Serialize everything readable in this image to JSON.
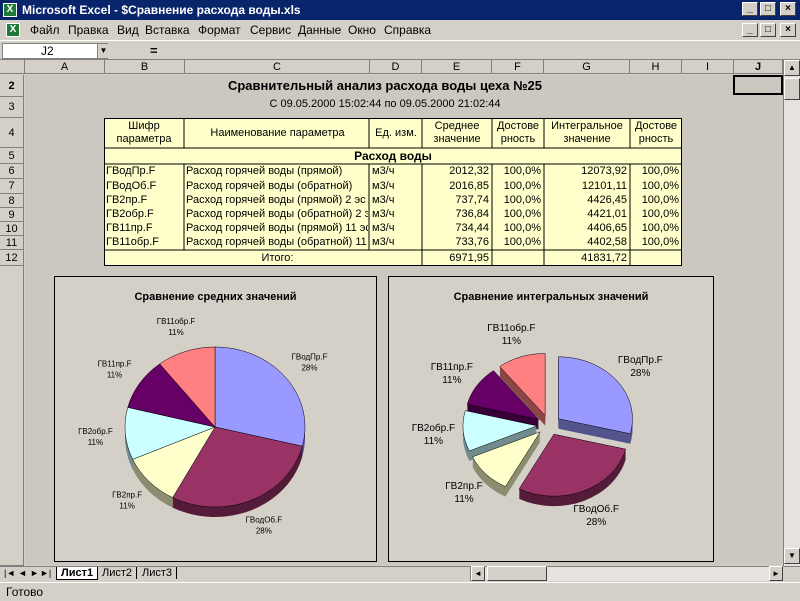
{
  "app": {
    "title": "Microsoft Excel - $Сравнение расхода воды.xls",
    "icon": "excel-icon"
  },
  "menu": [
    "Файл",
    "Правка",
    "Вид",
    "Вставка",
    "Формат",
    "Сервис",
    "Данные",
    "Окно",
    "Справка"
  ],
  "namebox": "J2",
  "formula_sign": "=",
  "columns": [
    "A",
    "B",
    "C",
    "D",
    "E",
    "F",
    "G",
    "H",
    "I",
    "J"
  ],
  "rows": [
    "2",
    "3",
    "4",
    "5",
    "6",
    "7",
    "8",
    "9",
    "10",
    "11",
    "12"
  ],
  "sheet": {
    "title": "Сравнительный анализ расхода воды цеха №25",
    "period": "С 09.05.2000 15:02:44 по 09.05.2000 21:02:44",
    "headers": [
      "Шифр параметра",
      "Наименование параметра",
      "Ед. изм.",
      "Среднее значение",
      "Достове рность",
      "Интегральное значение",
      "Достове рность"
    ],
    "section": "Расход воды",
    "table_rows": [
      [
        "ГВодПр.F",
        "Расход горячей воды (прямой)",
        "м3/ч",
        "2012,32",
        "100,0%",
        "12073,92",
        "100,0%"
      ],
      [
        "ГВодОб.F",
        "Расход горячей воды (обратной)",
        "м3/ч",
        "2016,85",
        "100,0%",
        "12101,11",
        "100,0%"
      ],
      [
        "ГВ2пр.F",
        "Расход горячей воды (прямой) 2 эс",
        "м3/ч",
        "737,74",
        "100,0%",
        "4426,45",
        "100,0%"
      ],
      [
        "ГВ2обр.F",
        "Расход горячей воды (обратной) 2 э",
        "м3/ч",
        "736,84",
        "100,0%",
        "4421,01",
        "100,0%"
      ],
      [
        "ГВ11пр.F",
        "Расход горячей воды (прямой) 11 эс",
        "м3/ч",
        "734,44",
        "100,0%",
        "4406,65",
        "100,0%"
      ],
      [
        "ГВ11обр.F",
        "Расход горячей воды (обратной) 11",
        "м3/ч",
        "733,76",
        "100,0%",
        "4402,58",
        "100,0%"
      ]
    ],
    "total_label": "Итого:",
    "total_avg": "6971,95",
    "total_int": "41831,72"
  },
  "chart_data": [
    {
      "type": "pie",
      "title": "Сравнение средних значений",
      "categories": [
        "ГВодПр.F",
        "ГВодОб.F",
        "ГВ2пр.F",
        "ГВ2обр.F",
        "ГВ11пр.F",
        "ГВ11обр.F"
      ],
      "values": [
        2012.32,
        2016.85,
        737.74,
        736.84,
        734.44,
        733.76
      ],
      "labels": [
        "28%",
        "28%",
        "11%",
        "11%",
        "11%",
        "11%"
      ],
      "colors": [
        "#9999ff",
        "#993366",
        "#ffffcc",
        "#ccffff",
        "#660066",
        "#ff8080"
      ]
    },
    {
      "type": "pie",
      "title": "Сравнение интегральных значений",
      "categories": [
        "ГВодПр.F",
        "ГВодОб.F",
        "ГВ2пр.F",
        "ГВ2обр.F",
        "ГВ11пр.F",
        "ГВ11обр.F"
      ],
      "values": [
        12073.92,
        12101.11,
        4426.45,
        4421.01,
        4406.65,
        4402.58
      ],
      "labels": [
        "28%",
        "28%",
        "11%",
        "11%",
        "11%",
        "11%"
      ],
      "colors": [
        "#9999ff",
        "#993366",
        "#ffffcc",
        "#ccffff",
        "#660066",
        "#ff8080"
      ]
    }
  ],
  "tabs": [
    "Лист1",
    "Лист2",
    "Лист3"
  ],
  "status": "Готово"
}
